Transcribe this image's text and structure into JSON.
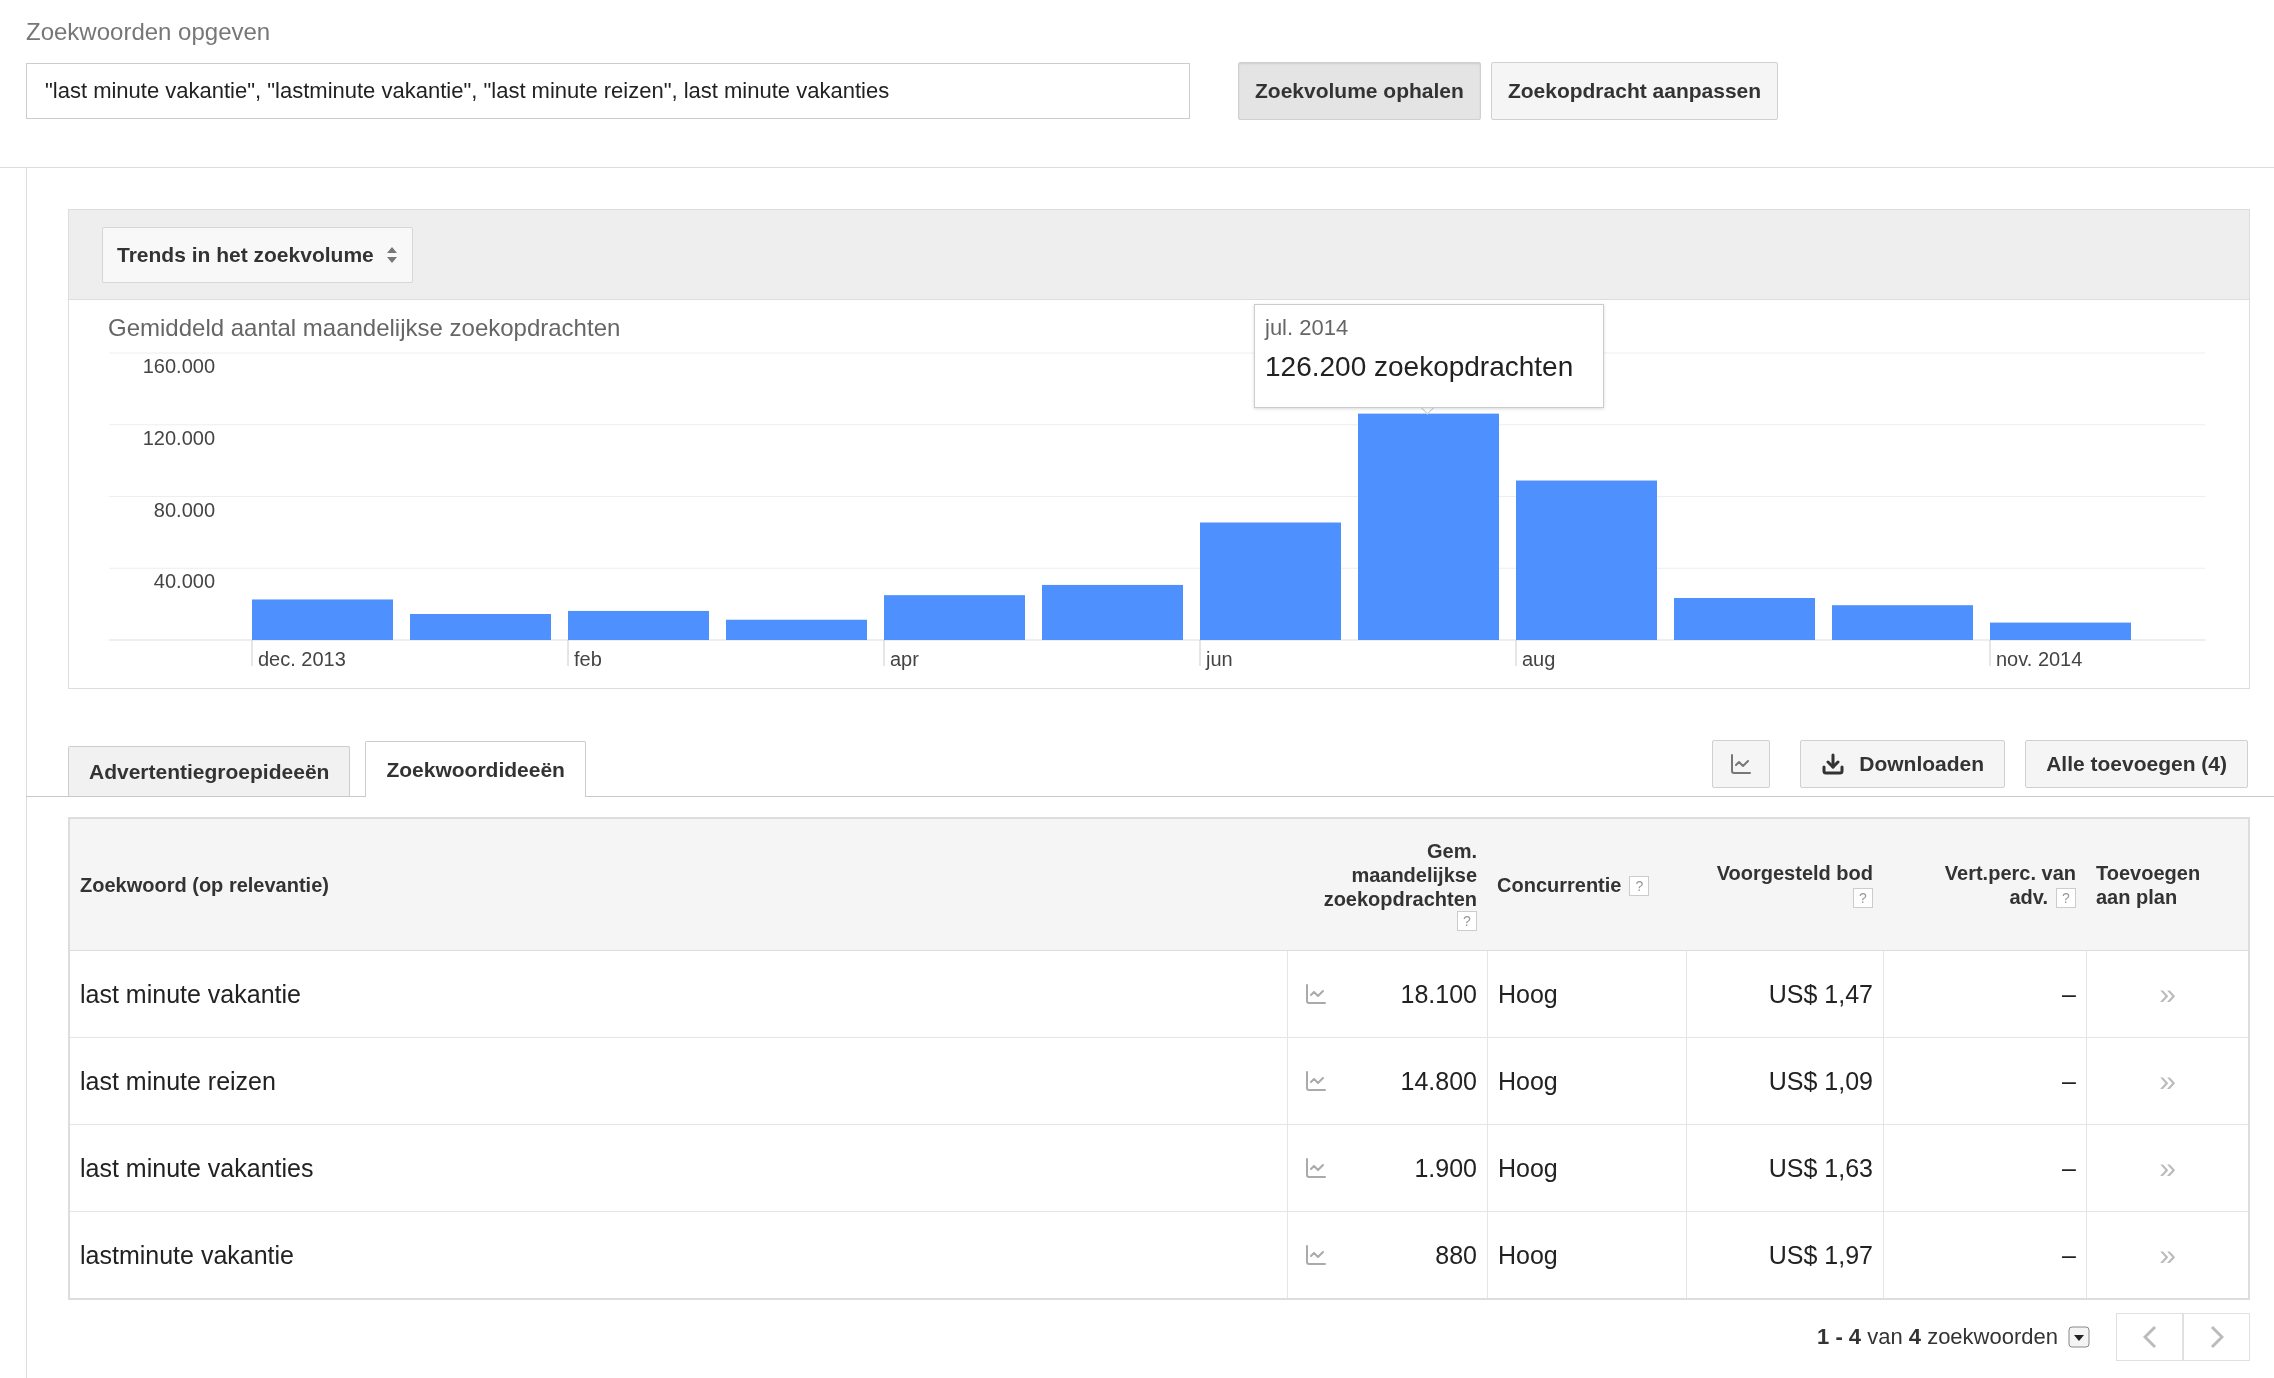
{
  "keyword_entry": {
    "label": "Zoekwoorden opgeven",
    "value": "\"last minute vakantie\", \"lastminute vakantie\", \"last minute reizen\", last minute vakanties"
  },
  "buttons": [
    {
      "label": "Zoekvolume ophalen",
      "kind": "primary"
    },
    {
      "label": "Zoekopdracht aanpassen",
      "kind": "secondary"
    }
  ],
  "chart_panel": {
    "selector": "Trends in het zoekvolume",
    "chart_data": {
      "type": "bar",
      "title": "Gemiddeld aantal maandelijkse zoekopdrachten",
      "categories": [
        "dec. 2013",
        null,
        "feb",
        null,
        "apr",
        null,
        "jun",
        null,
        "aug",
        null,
        null,
        "nov. 2014"
      ],
      "grid": true,
      "series": [
        {
          "color": "#4d90fe",
          "values": [
            22600,
            14500,
            16200,
            11300,
            25000,
            30700,
            65500,
            126200,
            88900,
            23400,
            19400,
            9700
          ]
        }
      ],
      "ylim": [
        0,
        160000
      ],
      "yticks": [
        {
          "value": 40000,
          "label": "40.000"
        },
        {
          "value": 80000,
          "label": "80.000"
        },
        {
          "value": 120000,
          "label": "120.000"
        },
        {
          "value": 160000,
          "label": "160.000"
        }
      ]
    },
    "tooltip": {
      "title": "jul. 2014",
      "text": "126.200 zoekopdrachten"
    }
  },
  "tabs": [
    {
      "label": "Advertentiegroepideeën",
      "selected": false
    },
    {
      "label": "Zoekwoordideeën",
      "selected": true
    }
  ],
  "actions": [
    {
      "kind": "chart"
    },
    {
      "kind": "download",
      "label": "Downloaden"
    },
    {
      "kind": "text",
      "label": "Alle toevoegen (4)"
    }
  ],
  "table": {
    "columns": [
      {
        "label": "Zoekwoord (op relevantie)"
      },
      {
        "label": "Gem. maandelijkse zoekopdrachten",
        "help": "?"
      },
      {
        "label": "Concurrentie",
        "help": "?"
      },
      {
        "label": "Voorgesteld bod",
        "help": "?"
      },
      {
        "label": "Vert.perc. van adv.",
        "help": "?"
      },
      {
        "label": "Toevoegen aan plan"
      }
    ],
    "rows": [
      {
        "keyword": "last minute vakantie",
        "volume": "18.100",
        "competition": "Hoog",
        "bid": "US$ 1,47",
        "share": "–",
        "add": "»"
      },
      {
        "keyword": "last minute reizen",
        "volume": "14.800",
        "competition": "Hoog",
        "bid": "US$ 1,09",
        "share": "–",
        "add": "»"
      },
      {
        "keyword": "last minute vakanties",
        "volume": "1.900",
        "competition": "Hoog",
        "bid": "US$ 1,63",
        "share": "–",
        "add": "»"
      },
      {
        "keyword": "lastminute vakantie",
        "volume": "880",
        "competition": "Hoog",
        "bid": "US$ 1,97",
        "share": "–",
        "add": "»"
      }
    ]
  },
  "pagination": {
    "summary": "**1 - 4** van **4** zoekwoorden"
  }
}
